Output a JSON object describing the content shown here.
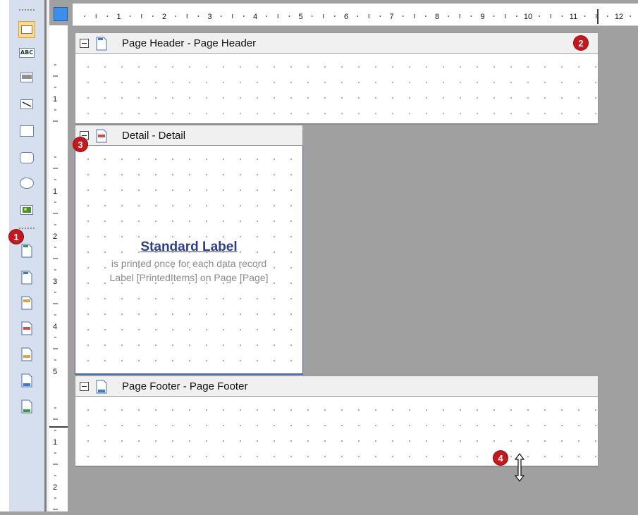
{
  "toolbox": {
    "tools": [
      {
        "name": "pointer-tool-icon",
        "selected": true
      },
      {
        "name": "label-tool-icon",
        "glyph": "ABC"
      },
      {
        "name": "barcode-tool-icon"
      },
      {
        "name": "line-tool-icon"
      },
      {
        "name": "rectangle-tool-icon"
      },
      {
        "name": "rounded-rectangle-tool-icon"
      },
      {
        "name": "ellipse-tool-icon"
      },
      {
        "name": "image-tool-icon"
      }
    ],
    "band_tools": [
      {
        "name": "band-tool-1-icon",
        "accent": "#3d9b3d"
      },
      {
        "name": "band-tool-2-icon",
        "accent": "#3a7bd5"
      },
      {
        "name": "band-tool-3-icon",
        "accent": "#e3a33a"
      },
      {
        "name": "band-tool-4-icon",
        "accent": "#d24a4a"
      },
      {
        "name": "band-tool-5-icon",
        "accent": "#e3a33a"
      },
      {
        "name": "band-tool-6-icon",
        "accent": "#3a7bd5"
      },
      {
        "name": "band-tool-7-icon",
        "accent": "#3d9b3d"
      }
    ]
  },
  "ruler": {
    "h_numbers": [
      "1",
      "2",
      "3",
      "4",
      "5",
      "6",
      "7",
      "8",
      "9",
      "10",
      "11",
      "12"
    ],
    "v_header_numbers": [
      "1"
    ],
    "v_detail_numbers": [
      "1",
      "2",
      "3",
      "4",
      "5"
    ],
    "v_footer_numbers": [
      "1",
      "2"
    ]
  },
  "bands": {
    "page_header": {
      "title": "Page Header - Page Header"
    },
    "detail": {
      "title": "Detail - Detail"
    },
    "page_footer": {
      "title": "Page Footer - Page Footer"
    }
  },
  "label": {
    "title": "Standard Label",
    "line1": "is printed once for each data record",
    "line2": "Label [PrintedItems] on Page [Page]"
  },
  "badges": [
    "1",
    "2",
    "3",
    "4"
  ],
  "colors": {
    "badge": "#c8161d",
    "label_title": "#2c3e8f",
    "workspace": "#a0a0a0"
  }
}
